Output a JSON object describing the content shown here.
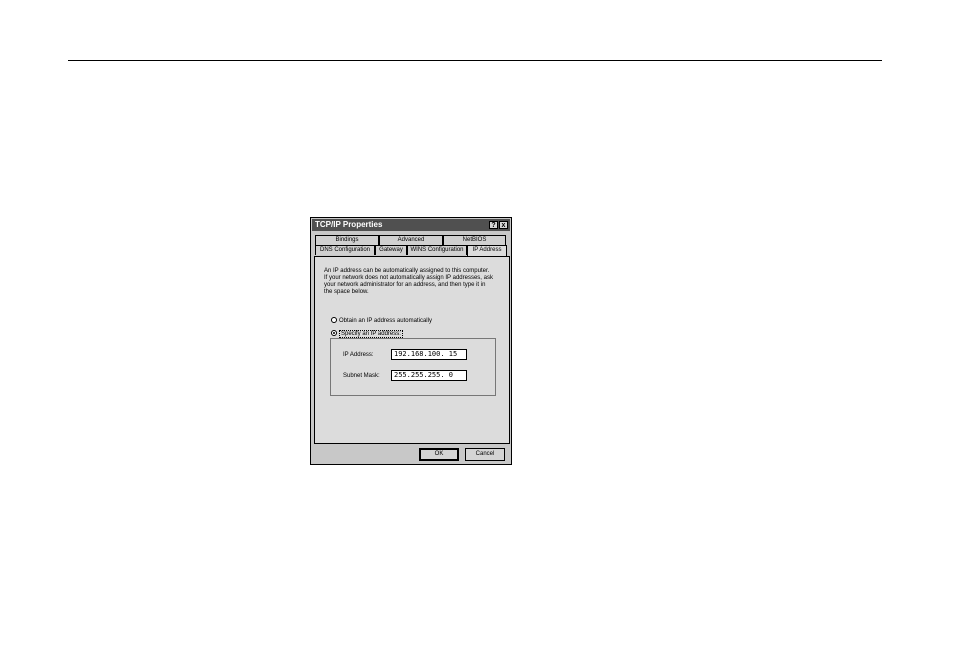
{
  "window": {
    "title": "TCP/IP Properties",
    "help_glyph": "?",
    "close_glyph": "x"
  },
  "tabs": {
    "row_back": [
      "Bindings",
      "Advanced",
      "NetBIOS"
    ],
    "row_front": [
      "DNS Configuration",
      "Gateway",
      "WINS Configuration",
      "IP Address"
    ],
    "active": "IP Address"
  },
  "description_lines": [
    "An IP address can be automatically assigned to this computer.",
    "If your network does not automatically assign IP addresses, ask",
    "your network administrator for an address, and then type it in",
    "the space below."
  ],
  "options": {
    "obtain_label": "Obtain an IP address automatically",
    "specify_label": "Specify an IP address:",
    "selected": "specify"
  },
  "fields": {
    "ip_label": "IP Address:",
    "ip_value": "192.168.100. 15",
    "mask_label": "Subnet Mask:",
    "mask_value": "255.255.255. 0"
  },
  "buttons": {
    "ok": "OK",
    "cancel": "Cancel"
  }
}
